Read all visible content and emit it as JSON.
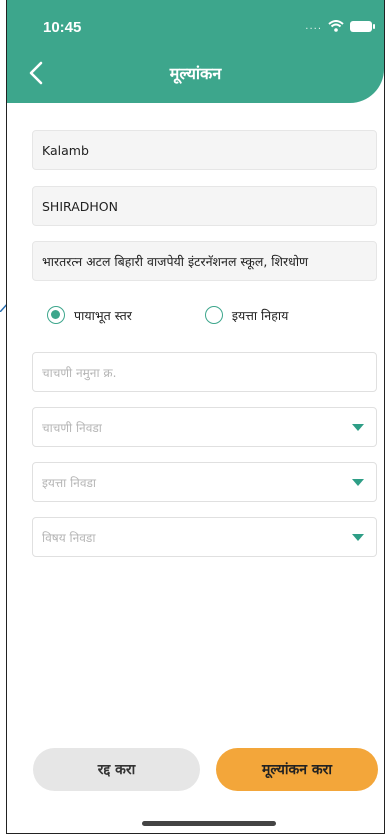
{
  "status_bar": {
    "time": "10:45",
    "signal_dots": "...."
  },
  "header": {
    "title": "मूल्यांकन"
  },
  "fields": {
    "district": "Kalamb",
    "village": "SHIRADHON",
    "school": "भारतरत्न अटल बिहारी वाजपेयी इंटरनॅशनल स्कूल, शिरधोण"
  },
  "radio": {
    "option1": {
      "label": "पायाभूत स्तर",
      "selected": true
    },
    "option2": {
      "label": "इयत्ता निहाय",
      "selected": false
    }
  },
  "inputs": {
    "test_sample_placeholder": "चाचणी नमुना क्र.",
    "test_select": "चाचणी निवडा",
    "grade_select": "इयत्ता निवडा",
    "subject_select": "विषय निवडा"
  },
  "buttons": {
    "cancel": "रद्द करा",
    "submit": "मूल्यांकन करा"
  },
  "colors": {
    "header": "#3da68c",
    "accent": "#2e9e86",
    "submit": "#f3a63a",
    "cancel": "#e6e6e6"
  }
}
